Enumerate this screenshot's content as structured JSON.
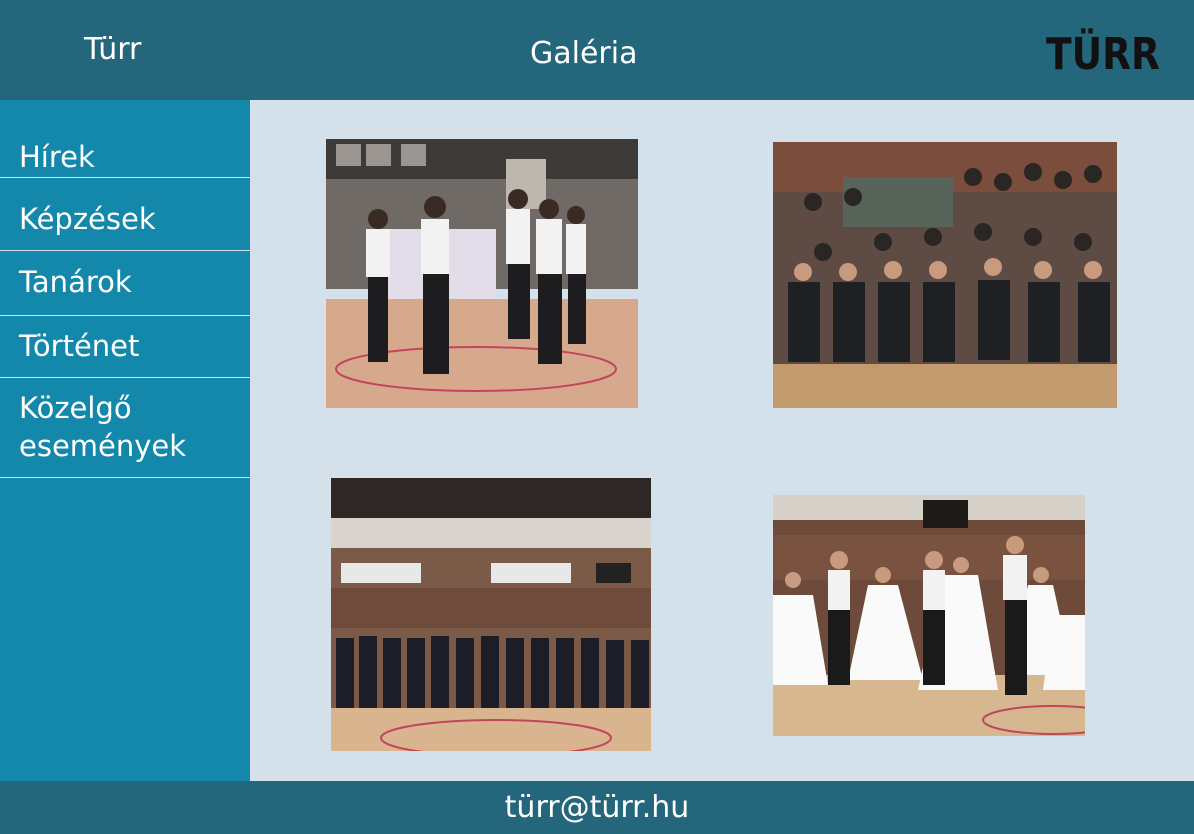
{
  "header": {
    "brand": "Türr",
    "title": "Galéria",
    "logo_text": "TÜRR"
  },
  "sidebar": {
    "items": [
      {
        "label": "Hírek"
      },
      {
        "label": "Képzések"
      },
      {
        "label": "Tanárok"
      },
      {
        "label": "Történet"
      },
      {
        "label": "Közelgő\nesemények"
      }
    ]
  },
  "gallery": {
    "photos": [
      {
        "name": "dance-performance-photo"
      },
      {
        "name": "seated-audience-photo"
      },
      {
        "name": "students-lineup-photo"
      },
      {
        "name": "ballroom-dance-photo"
      }
    ]
  },
  "footer": {
    "email": "türr@türr.hu"
  },
  "colors": {
    "header_bg": "#24677c",
    "sidebar_bg": "#1488aa",
    "content_bg": "#d5e1ea"
  }
}
